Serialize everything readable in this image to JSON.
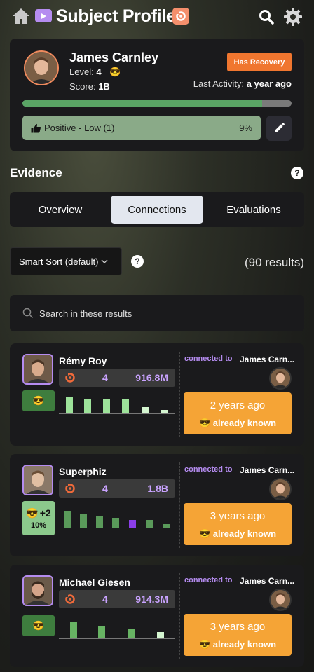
{
  "header": {
    "title": "Subject Profile"
  },
  "profile": {
    "name": "James Carnley",
    "level_label": "Level:",
    "level_value": "4",
    "level_emoji": "😎",
    "score_label": "Score:",
    "score_value": "1B",
    "recovery_badge": "Has Recovery",
    "last_activity_label": "Last Activity:",
    "last_activity_value": "a year ago",
    "progress_fraction": 0.89,
    "sentiment_label": "Positive - Low (1)",
    "sentiment_pct": "9%"
  },
  "evidence": {
    "title": "Evidence",
    "tabs": [
      "Overview",
      "Connections",
      "Evaluations"
    ],
    "active_tab": 1
  },
  "controls": {
    "sort_label": "Smart Sort (default)",
    "results": "(90 results)",
    "search_placeholder": "Search in these results"
  },
  "connections": [
    {
      "name": "Rémy Roy",
      "count": "4",
      "score": "916.8M",
      "tag_emoji": "😎",
      "tag_extra": "",
      "tag_pct": "",
      "bars": [
        0.75,
        0.65,
        0.65,
        0.65,
        0.3,
        0.15
      ],
      "connected_label": "connected to",
      "connected_to": "James Carn...",
      "ago": "2 years ago",
      "known_emoji": "😎",
      "known_label": "already known"
    },
    {
      "name": "Superphiz",
      "count": "4",
      "score": "1.8B",
      "tag_emoji": "😎",
      "tag_extra": "+2",
      "tag_pct": "10%",
      "bars": [
        0.8,
        0.65,
        0.55,
        0.45,
        0.35,
        0.35,
        0.15
      ],
      "connected_label": "connected to",
      "connected_to": "James Carn...",
      "ago": "3 years ago",
      "known_emoji": "😎",
      "known_label": "already known"
    },
    {
      "name": "Michael Giesen",
      "count": "4",
      "score": "914.3M",
      "tag_emoji": "😎",
      "tag_extra": "",
      "tag_pct": "",
      "bars": [
        0.8,
        0.55,
        0.45,
        0.3
      ],
      "connected_label": "connected to",
      "connected_to": "James Carn...",
      "ago": "3 years ago",
      "known_emoji": "😎",
      "known_label": "already known"
    }
  ]
}
